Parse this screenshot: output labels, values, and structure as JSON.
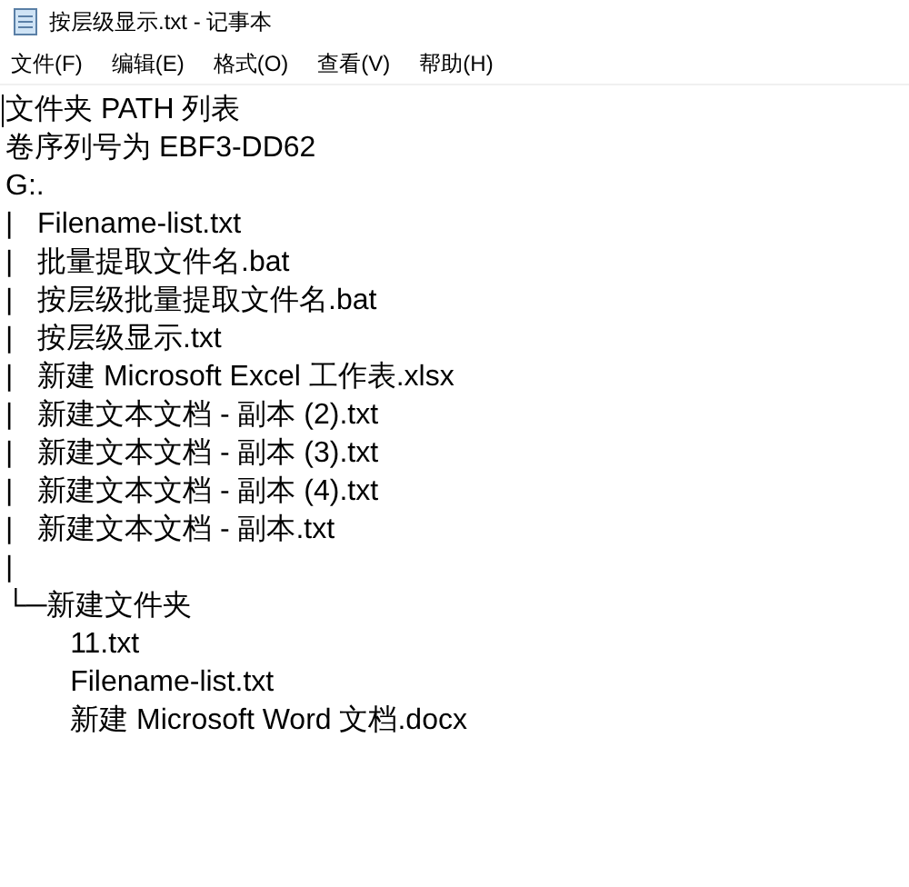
{
  "window": {
    "title": "按层级显示.txt - 记事本"
  },
  "menu": [
    "文件(F)",
    "编辑(E)",
    "格式(O)",
    "查看(V)",
    "帮助(H)"
  ],
  "lines": [
    "文件夹 PATH 列表",
    "卷序列号为 EBF3-DD62",
    "G:.",
    "|   Filename-list.txt",
    "|   批量提取文件名.bat",
    "|   按层级批量提取文件名.bat",
    "|   按层级显示.txt",
    "|   新建 Microsoft Excel 工作表.xlsx",
    "|   新建文本文档 - 副本 (2).txt",
    "|   新建文本文档 - 副本 (3).txt",
    "|   新建文本文档 - 副本 (4).txt",
    "|   新建文本文档 - 副本.txt",
    "|",
    "└─新建文件夹",
    "        11.txt",
    "        Filename-list.txt",
    "        新建 Microsoft Word 文档.docx"
  ]
}
